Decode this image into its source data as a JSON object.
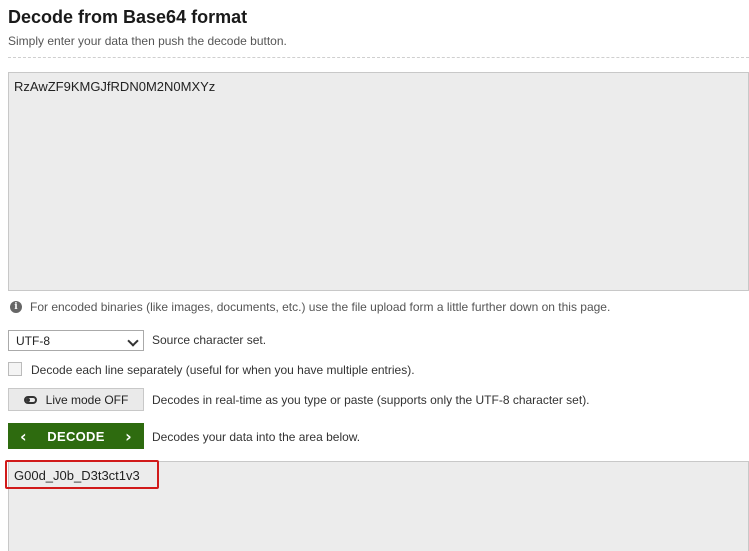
{
  "header": {
    "title": "Decode from Base64 format",
    "subtitle": "Simply enter your data then push the decode button."
  },
  "input": {
    "value": "RzAwZF9KMGJfRDN0M2N0MXYz"
  },
  "hint": {
    "icon": "info-icon",
    "text": "For encoded binaries (like images, documents, etc.) use the file upload form a little further down on this page."
  },
  "charset": {
    "selected": "UTF-8",
    "label": "Source character set."
  },
  "separate_lines": {
    "checked": false,
    "label": "Decode each line separately (useful for when you have multiple entries)."
  },
  "live_mode": {
    "button_label": "Live mode OFF",
    "description": "Decodes in real-time as you type or paste (supports only the UTF-8 character set)."
  },
  "decode": {
    "button_label": "DECODE",
    "description": "Decodes your data into the area below.",
    "color": "#2e6b0f"
  },
  "output": {
    "value": "G00d_J0b_D3t3ct1v3",
    "highlight_color": "#d11a1a"
  }
}
